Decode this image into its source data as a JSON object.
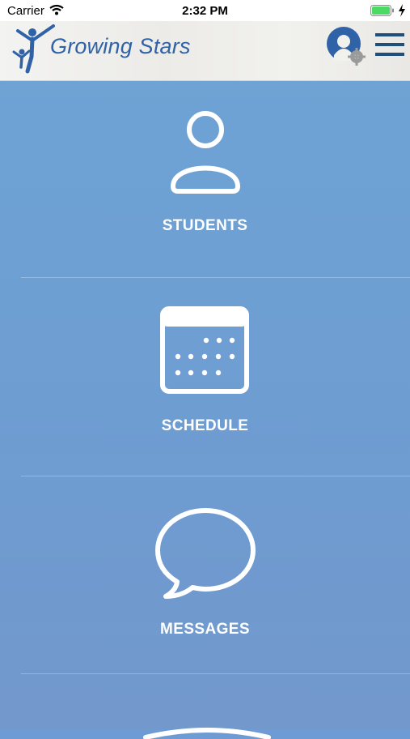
{
  "status_bar": {
    "carrier": "Carrier",
    "time": "2:32 PM",
    "icons": [
      "wifi-icon",
      "battery-icon",
      "charging-bolt-icon"
    ],
    "battery_color": "#4cd964"
  },
  "header": {
    "brand": "Growing Stars",
    "brand_color": "#2f62a6",
    "icons": [
      "logo-figures-icon",
      "profile-settings-icon",
      "hamburger-menu-icon"
    ]
  },
  "menu": {
    "items": [
      {
        "label": "STUDENTS",
        "icon": "person-icon"
      },
      {
        "label": "SCHEDULE",
        "icon": "calendar-icon"
      },
      {
        "label": "MESSAGES",
        "icon": "speech-bubble-icon"
      },
      {
        "label": "",
        "icon": "partially-visible-icon"
      }
    ]
  },
  "colors": {
    "background_top": "#6ea3d4",
    "background_bottom": "#7298cc",
    "tile_text": "#ffffff",
    "header_icon": "#1f4f7a"
  }
}
